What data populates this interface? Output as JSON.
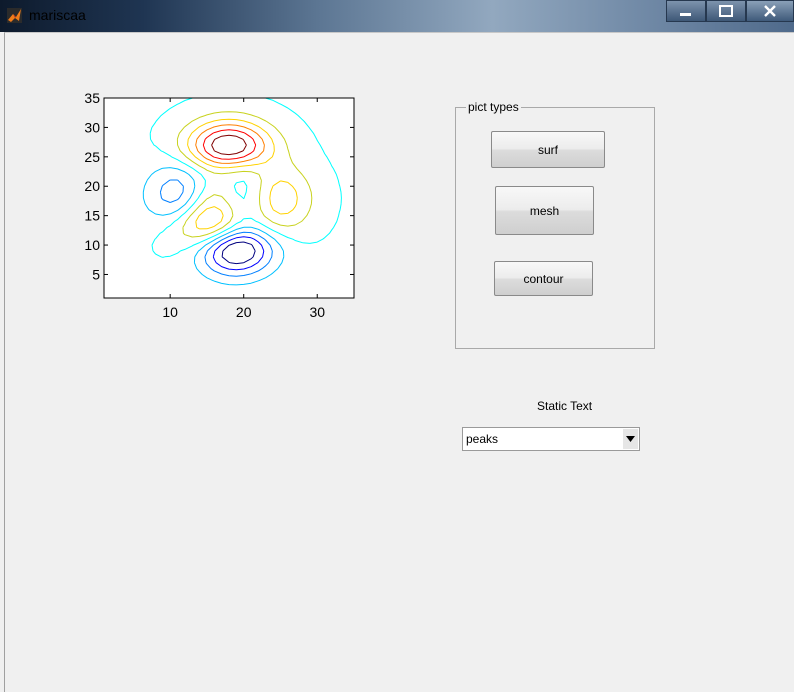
{
  "window": {
    "title": "mariscaa"
  },
  "panel": {
    "title": "pict types",
    "buttons": {
      "surf": "surf",
      "mesh": "mesh",
      "contour": "contour"
    }
  },
  "static_text": "Static Text",
  "popup": {
    "value": "peaks"
  },
  "chart_data": {
    "type": "contour",
    "title": "",
    "xlabel": "",
    "ylabel": "",
    "xlim": [
      1,
      35
    ],
    "ylim": [
      1,
      35
    ],
    "xticks": [
      10,
      20,
      30
    ],
    "yticks": [
      5,
      10,
      15,
      20,
      25,
      30,
      35
    ],
    "function": "peaks",
    "grid": false,
    "level_colors": [
      "#00007f",
      "#0000ff",
      "#007fff",
      "#00c0ff",
      "#00ffff",
      "#c8d21e",
      "#ffd200",
      "#ff7f00",
      "#ff0000",
      "#7f0000"
    ]
  }
}
